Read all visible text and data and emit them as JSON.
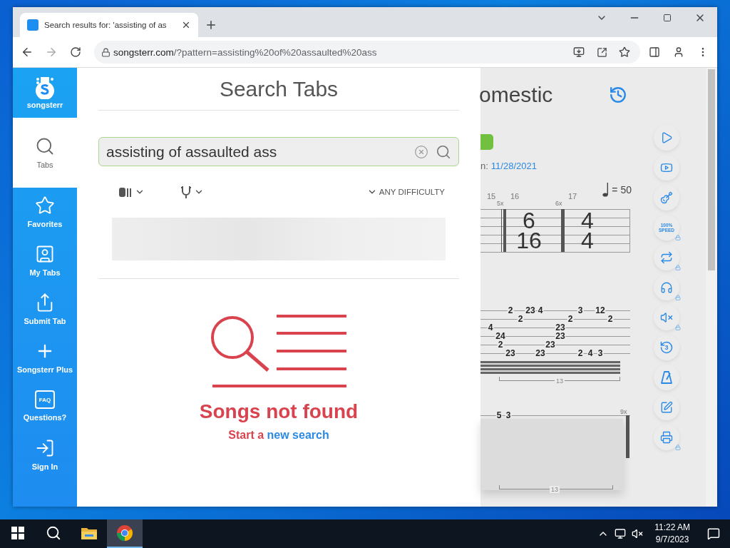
{
  "browser": {
    "tab_title": "Search results for: 'assisting of as",
    "url_host": "songsterr.com",
    "url_path": "/?pattern=assisting%20of%20assaulted%20ass"
  },
  "sidebar": {
    "logo_text": "songsterr",
    "items": [
      {
        "kind": "search",
        "label": "Tabs",
        "selected": true
      },
      {
        "kind": "favorites",
        "label": "Favorites",
        "selected": false
      },
      {
        "kind": "mytabs",
        "label": "My Tabs",
        "selected": false
      },
      {
        "kind": "submit",
        "label": "Submit Tab",
        "selected": false
      },
      {
        "kind": "plus",
        "label": "Songsterr Plus",
        "selected": false
      },
      {
        "kind": "faq",
        "label": "Questions?",
        "icon_text": "FAQ",
        "selected": false
      },
      {
        "kind": "signin",
        "label": "Sign In",
        "selected": false
      }
    ]
  },
  "search_panel": {
    "title": "Search Tabs",
    "query": "assisting of assaulted ass",
    "filters": [
      {
        "kind": "instrument"
      },
      {
        "kind": "tuning"
      },
      {
        "kind": "difficulty",
        "label": "ANY DIFFICULTY"
      }
    ],
    "empty": {
      "title": "Songs not found",
      "prefix": "Start a",
      "link": "new search"
    }
  },
  "background_page": {
    "title": "omestic",
    "date_prefix": "n:",
    "date": "11/28/2021",
    "tempo": "= 50",
    "measures": [
      {
        "number": "15",
        "repeat": "5x"
      },
      {
        "number": "16",
        "repeat": "6x",
        "time": [
          "6",
          "16"
        ]
      },
      {
        "number": "17",
        "time": [
          "4",
          "4"
        ]
      }
    ],
    "tab_strings": [
      [
        "2",
        "23",
        "4",
        "3",
        "12"
      ],
      [
        "2",
        "2",
        "2"
      ],
      [
        "4",
        "23"
      ],
      [
        "24",
        "23"
      ],
      [
        "2",
        "23"
      ],
      [
        "23",
        "23",
        "2",
        "4",
        "3"
      ]
    ],
    "tuplet": "13",
    "lower_notes": [
      "5",
      "3"
    ],
    "lower_repeat": "9x",
    "lower_tuplet": "13",
    "tools": [
      {
        "kind": "play",
        "locked": false
      },
      {
        "kind": "video",
        "locked": false
      },
      {
        "kind": "guitar",
        "locked": false
      },
      {
        "kind": "speed",
        "locked": true,
        "lines": [
          "100%",
          "SPEED"
        ]
      },
      {
        "kind": "loop",
        "locked": true
      },
      {
        "kind": "headphones",
        "locked": true
      },
      {
        "kind": "mute",
        "locked": true
      },
      {
        "kind": "countdown",
        "locked": false,
        "text": "3"
      },
      {
        "kind": "metronome",
        "locked": false
      },
      {
        "kind": "edit",
        "locked": false
      },
      {
        "kind": "print",
        "locked": true
      }
    ]
  },
  "taskbar": {
    "apps": [
      {
        "kind": "explorer",
        "selected": false
      },
      {
        "kind": "chrome",
        "selected": true
      }
    ],
    "time": "11:22 AM",
    "date": "9/7/2023"
  }
}
